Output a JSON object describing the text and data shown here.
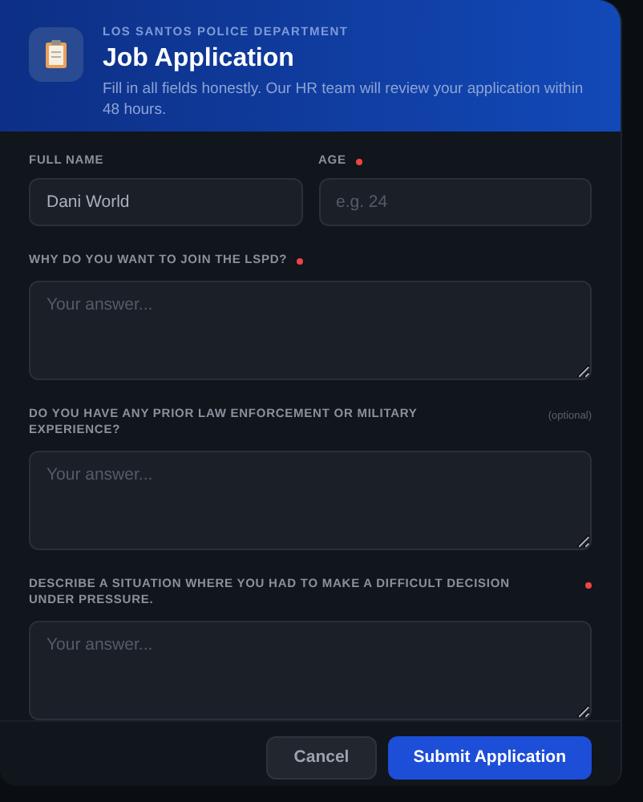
{
  "header": {
    "department": "LOS SANTOS POLICE DEPARTMENT",
    "title": "Job Application",
    "subtitle": "Fill in all fields honestly. Our HR team will review your application within 48 hours."
  },
  "fields": [
    {
      "label": "FULL NAME",
      "required": false,
      "value": "Dani World"
    },
    {
      "label": "AGE",
      "required": true,
      "placeholder": "e.g. 24"
    }
  ],
  "questions": [
    {
      "label": "WHY DO YOU WANT TO JOIN THE LSPD?",
      "required": true,
      "placeholder": "Your answer..."
    },
    {
      "label": "DO YOU HAVE ANY PRIOR LAW ENFORCEMENT OR MILITARY EXPERIENCE?",
      "required": false,
      "note": "(optional)",
      "placeholder": "Your answer..."
    },
    {
      "label": "DESCRIBE A SITUATION WHERE YOU HAD TO MAKE A DIFFICULT DECISION UNDER PRESSURE.",
      "required": true,
      "placeholder": "Your answer..."
    }
  ],
  "buttons": [
    {
      "label": "Cancel",
      "kind": "secondary"
    },
    {
      "label": "Submit Application",
      "kind": "primary"
    }
  ]
}
